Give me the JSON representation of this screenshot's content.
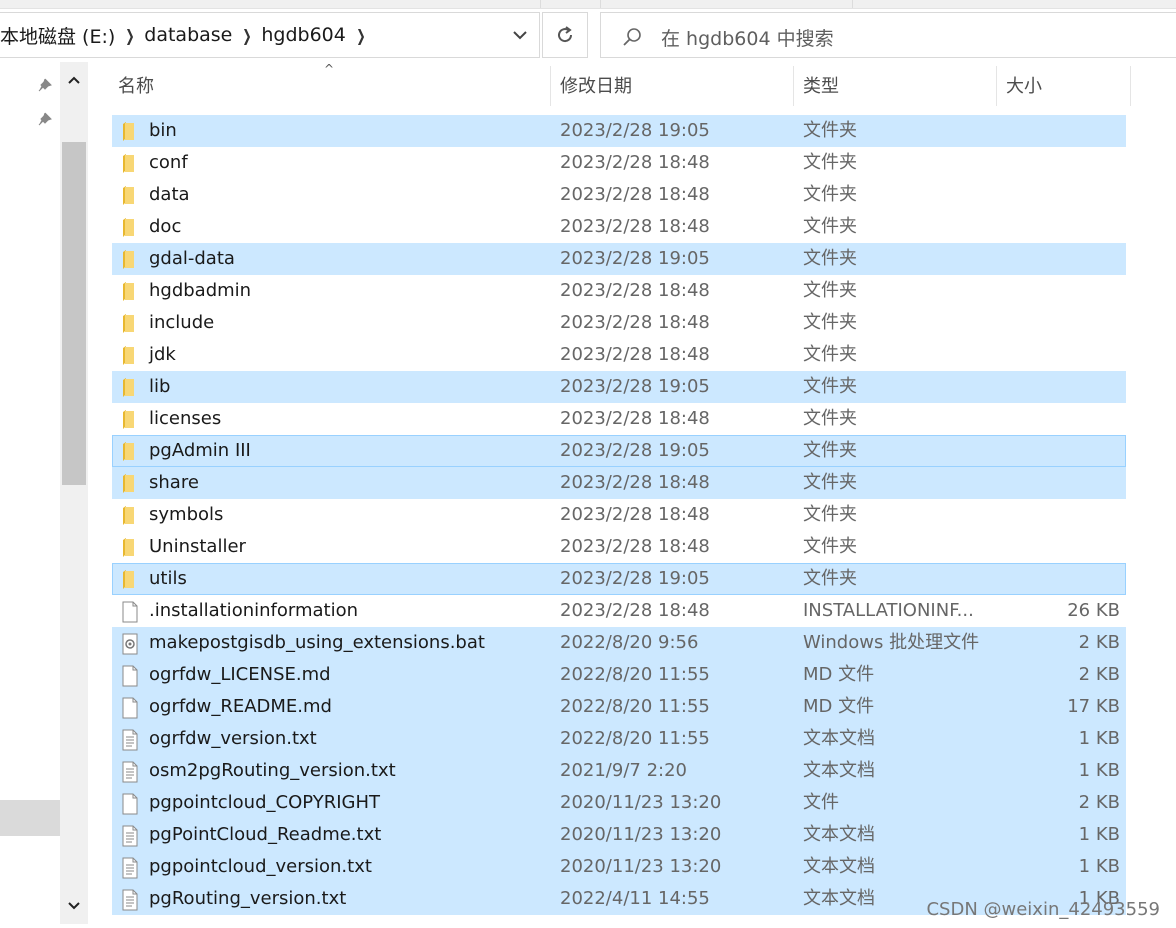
{
  "address": {
    "crumbs": [
      "本地磁盘 (E:)",
      "database",
      "hgdb604"
    ]
  },
  "search": {
    "placeholder": "在 hgdb604 中搜索"
  },
  "columns": {
    "name": "名称",
    "date": "修改日期",
    "type": "类型",
    "size": "大小"
  },
  "files": [
    {
      "name": "bin",
      "date": "2023/2/28 19:05",
      "type": "文件夹",
      "size": "",
      "icon": "folder-icon",
      "selected": true
    },
    {
      "name": "conf",
      "date": "2023/2/28 18:48",
      "type": "文件夹",
      "size": "",
      "icon": "folder-icon",
      "selected": false
    },
    {
      "name": "data",
      "date": "2023/2/28 18:48",
      "type": "文件夹",
      "size": "",
      "icon": "folder-icon",
      "selected": false
    },
    {
      "name": "doc",
      "date": "2023/2/28 18:48",
      "type": "文件夹",
      "size": "",
      "icon": "folder-icon",
      "selected": false
    },
    {
      "name": "gdal-data",
      "date": "2023/2/28 19:05",
      "type": "文件夹",
      "size": "",
      "icon": "folder-icon",
      "selected": true
    },
    {
      "name": "hgdbadmin",
      "date": "2023/2/28 18:48",
      "type": "文件夹",
      "size": "",
      "icon": "folder-icon",
      "selected": false
    },
    {
      "name": "include",
      "date": "2023/2/28 18:48",
      "type": "文件夹",
      "size": "",
      "icon": "folder-icon",
      "selected": false
    },
    {
      "name": "jdk",
      "date": "2023/2/28 18:48",
      "type": "文件夹",
      "size": "",
      "icon": "folder-icon",
      "selected": false
    },
    {
      "name": "lib",
      "date": "2023/2/28 19:05",
      "type": "文件夹",
      "size": "",
      "icon": "folder-icon",
      "selected": true
    },
    {
      "name": "licenses",
      "date": "2023/2/28 18:48",
      "type": "文件夹",
      "size": "",
      "icon": "folder-icon",
      "selected": false
    },
    {
      "name": "pgAdmin III",
      "date": "2023/2/28 19:05",
      "type": "文件夹",
      "size": "",
      "icon": "folder-icon",
      "selected": true,
      "focus": true
    },
    {
      "name": "share",
      "date": "2023/2/28 18:48",
      "type": "文件夹",
      "size": "",
      "icon": "folder-icon",
      "selected": true
    },
    {
      "name": "symbols",
      "date": "2023/2/28 18:48",
      "type": "文件夹",
      "size": "",
      "icon": "folder-icon",
      "selected": false
    },
    {
      "name": "Uninstaller",
      "date": "2023/2/28 18:48",
      "type": "文件夹",
      "size": "",
      "icon": "folder-icon",
      "selected": false
    },
    {
      "name": "utils",
      "date": "2023/2/28 19:05",
      "type": "文件夹",
      "size": "",
      "icon": "folder-icon",
      "selected": true,
      "focus": true
    },
    {
      "name": ".installationinformation",
      "date": "2023/2/28 18:48",
      "type": "INSTALLATIONINF...",
      "size": "26 KB",
      "icon": "file-icon",
      "selected": false
    },
    {
      "name": "makepostgisdb_using_extensions.bat",
      "date": "2022/8/20 9:56",
      "type": "Windows 批处理文件",
      "size": "2 KB",
      "icon": "batch-file-icon",
      "selected": true
    },
    {
      "name": "ogrfdw_LICENSE.md",
      "date": "2022/8/20 11:55",
      "type": "MD 文件",
      "size": "2 KB",
      "icon": "file-icon",
      "selected": true
    },
    {
      "name": "ogrfdw_README.md",
      "date": "2022/8/20 11:55",
      "type": "MD 文件",
      "size": "17 KB",
      "icon": "file-icon",
      "selected": true
    },
    {
      "name": "ogrfdw_version.txt",
      "date": "2022/8/20 11:55",
      "type": "文本文档",
      "size": "1 KB",
      "icon": "text-file-icon",
      "selected": true
    },
    {
      "name": "osm2pgRouting_version.txt",
      "date": "2021/9/7 2:20",
      "type": "文本文档",
      "size": "1 KB",
      "icon": "text-file-icon",
      "selected": true
    },
    {
      "name": "pgpointcloud_COPYRIGHT",
      "date": "2020/11/23 13:20",
      "type": "文件",
      "size": "2 KB",
      "icon": "file-icon",
      "selected": true
    },
    {
      "name": "pgPointCloud_Readme.txt",
      "date": "2020/11/23 13:20",
      "type": "文本文档",
      "size": "1 KB",
      "icon": "text-file-icon",
      "selected": true
    },
    {
      "name": "pgpointcloud_version.txt",
      "date": "2020/11/23 13:20",
      "type": "文本文档",
      "size": "1 KB",
      "icon": "text-file-icon",
      "selected": true
    },
    {
      "name": "pgRouting_version.txt",
      "date": "2022/4/11 14:55",
      "type": "文本文档",
      "size": "1 KB",
      "icon": "text-file-icon",
      "selected": true
    }
  ],
  "watermark": "CSDN @weixin_42493559",
  "colors": {
    "selection": "#cce8ff",
    "focus_border": "#99d1ff",
    "folder": "#f8d775"
  }
}
